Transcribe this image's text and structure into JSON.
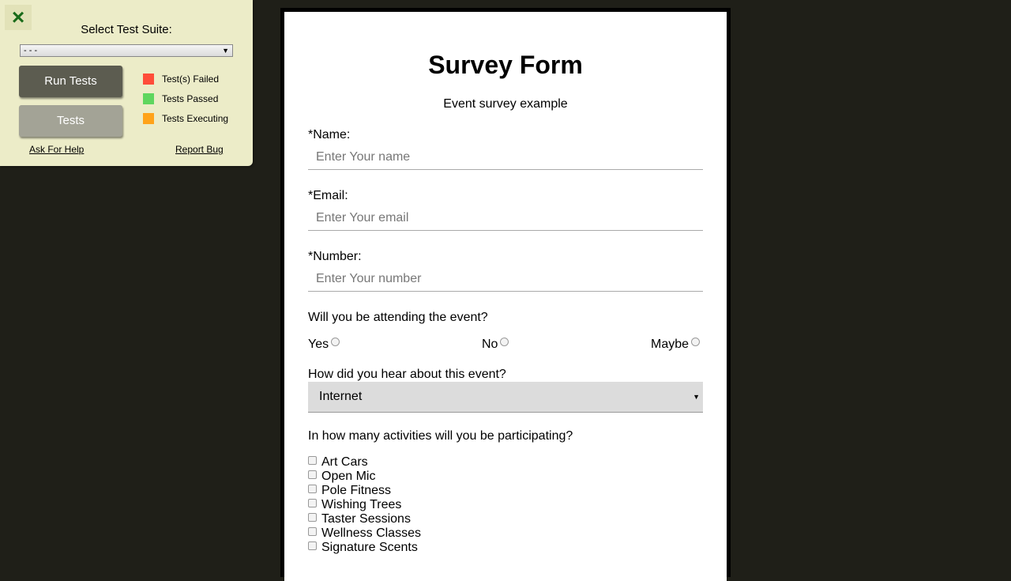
{
  "test_panel": {
    "close_icon": "×",
    "suite_label": "Select Test Suite:",
    "suite_select_value": "- - -",
    "select_arrow": "▼",
    "run_tests_label": "Run Tests",
    "tests_label": "Tests",
    "legend": [
      {
        "label": "Test(s) Failed",
        "color": "#ff4d3a"
      },
      {
        "label": "Tests Passed",
        "color": "#5fd65f"
      },
      {
        "label": "Tests Executing",
        "color": "#ffa31a"
      }
    ],
    "ask_help_label": "Ask For Help",
    "report_bug_label": "Report Bug"
  },
  "form": {
    "title": "Survey Form",
    "description": "Event survey example",
    "name_label": "*Name:",
    "name_placeholder": "Enter Your name",
    "email_label": "*Email:",
    "email_placeholder": "Enter Your email",
    "number_label": "*Number:",
    "number_placeholder": "Enter Your number",
    "attend_question": "Will you be attending the event?",
    "attend_options": [
      "Yes",
      "No",
      "Maybe"
    ],
    "hear_question": "How did you hear about this event?",
    "hear_selected": "Internet",
    "select_arrow": "▼",
    "activities_question": "In how many activities will you be participating?",
    "activities": [
      "Art Cars",
      "Open Mic",
      "Pole Fitness",
      "Wishing Trees",
      "Taster Sessions",
      "Wellness Classes",
      "Signature Scents"
    ]
  }
}
